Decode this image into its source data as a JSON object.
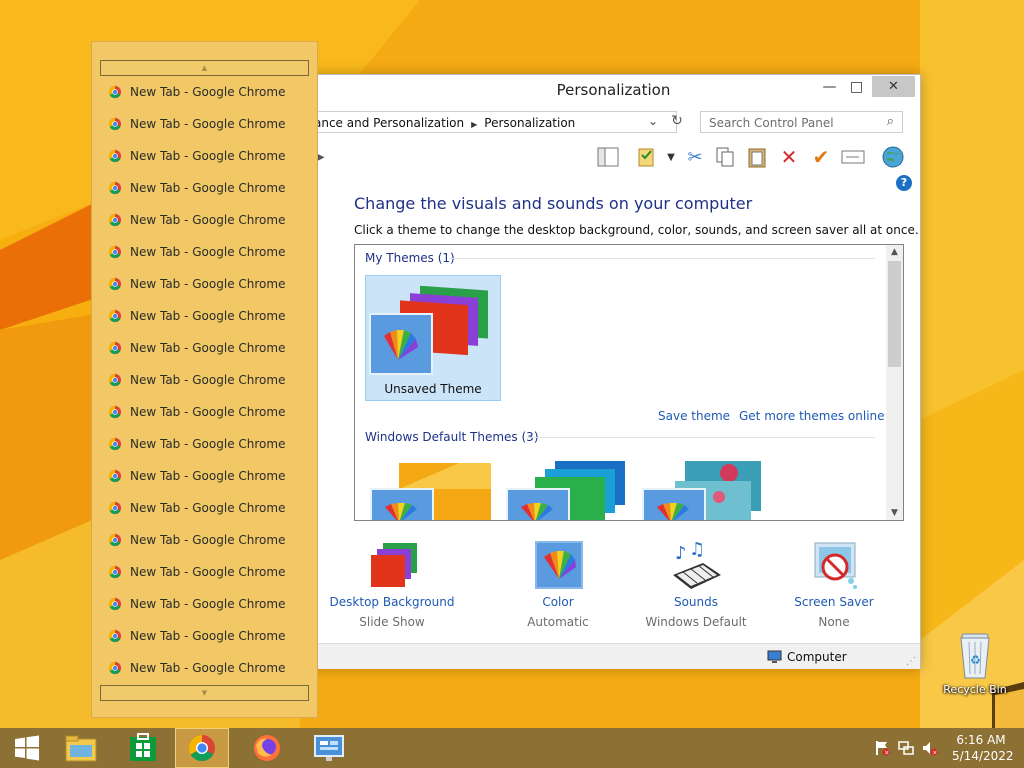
{
  "window": {
    "title": "Personalization",
    "minimize_glyph": "—",
    "maximize_glyph": "□",
    "close_glyph": "✕"
  },
  "address": {
    "crumbs": [
      "ance and Personalization",
      "Personalization"
    ],
    "search_placeholder": "Search Control Panel"
  },
  "toolbar": {
    "icons": [
      "layout-icon",
      "properties-icon",
      "cut-icon",
      "copy-icon",
      "paste-icon",
      "delete-icon",
      "check-icon",
      "rename-icon",
      "globe-icon"
    ]
  },
  "main": {
    "heading": "Change the visuals and sounds on your computer",
    "subheading": "Click a theme to change the desktop background, color, sounds, and screen saver all at once.",
    "my_themes_label": "My Themes (1)",
    "my_theme_name": "Unsaved Theme",
    "save_theme_link": "Save theme",
    "more_themes_link": "Get more themes online",
    "default_themes_label": "Windows Default Themes (3)"
  },
  "bottom": [
    {
      "link": "Desktop Background",
      "sub": "Slide Show",
      "icon": "desktop-background-icon"
    },
    {
      "link": "Color",
      "sub": "Automatic",
      "icon": "color-icon"
    },
    {
      "link": "Sounds",
      "sub": "Windows Default",
      "icon": "sounds-icon"
    },
    {
      "link": "Screen Saver",
      "sub": "None",
      "icon": "screen-saver-icon"
    }
  ],
  "status": {
    "location": "Computer"
  },
  "jumplist": {
    "items": [
      "New Tab - Google Chrome",
      "New Tab - Google Chrome",
      "New Tab - Google Chrome",
      "New Tab - Google Chrome",
      "New Tab - Google Chrome",
      "New Tab - Google Chrome",
      "New Tab - Google Chrome",
      "New Tab - Google Chrome",
      "New Tab - Google Chrome",
      "New Tab - Google Chrome",
      "New Tab - Google Chrome",
      "New Tab - Google Chrome",
      "New Tab - Google Chrome",
      "New Tab - Google Chrome",
      "New Tab - Google Chrome",
      "New Tab - Google Chrome",
      "New Tab - Google Chrome",
      "New Tab - Google Chrome",
      "New Tab - Google Chrome"
    ]
  },
  "desktop": {
    "recycle_bin_label": "Recycle Bin"
  },
  "taskbar": {
    "buttons": [
      "start",
      "file-explorer",
      "store",
      "chrome",
      "firefox",
      "control-panel"
    ],
    "time": "6:16 AM",
    "date": "5/14/2022"
  },
  "colors": {
    "wallpaper": "#f3a814",
    "link": "#1e5ab4",
    "heading": "#1e3287",
    "taskbar": "#8c7034",
    "jumplist": "#f1c865"
  }
}
